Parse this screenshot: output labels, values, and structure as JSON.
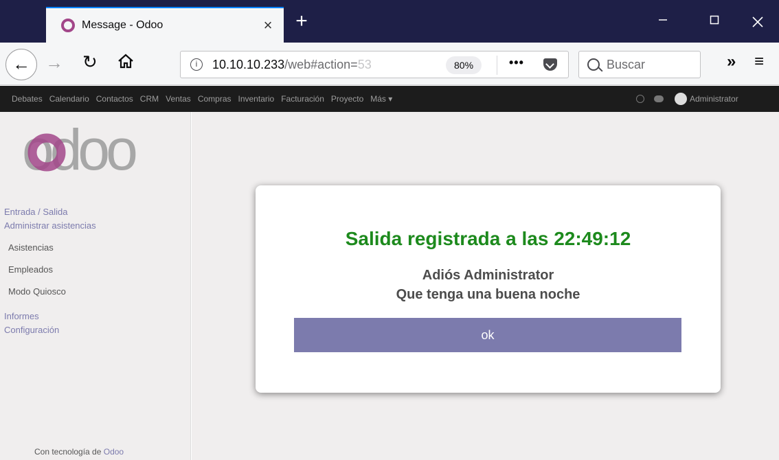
{
  "browser": {
    "tab_title": "Message - Odoo",
    "tab_close": "×",
    "new_tab": "+",
    "url_host": "10.10.10.233",
    "url_path": "/web#action=",
    "url_fade": "53",
    "zoom": "80%",
    "page_actions": "•••",
    "search_placeholder": "Buscar",
    "overflow": "»",
    "menu": "≡"
  },
  "odoo_menu": {
    "items": [
      "Debates",
      "Calendario",
      "Contactos",
      "CRM",
      "Ventas",
      "Compras",
      "Inventario",
      "Facturación",
      "Proyecto",
      "Más ▾"
    ],
    "user": "Administrator"
  },
  "sidebar": {
    "logo_text": "odoo",
    "section1": "Entrada / Salida",
    "section2": "Administrar asistencias",
    "items": [
      "Asistencias",
      "Empleados",
      "Modo Quiosco"
    ],
    "section3": "Informes",
    "section4": "Configuración",
    "powered_prefix": "Con tecnología de ",
    "powered_brand": "Odoo"
  },
  "dialog": {
    "title": "Salida registrada a las 22:49:12",
    "line1": "Adiós Administrator",
    "line2": "Que tenga una buena noche",
    "ok_label": "ok"
  },
  "colors": {
    "accent": "#7c7bad",
    "success": "#1d8a1d",
    "topbar": "#1c1c1c",
    "tabstrip": "#1e1f47"
  }
}
